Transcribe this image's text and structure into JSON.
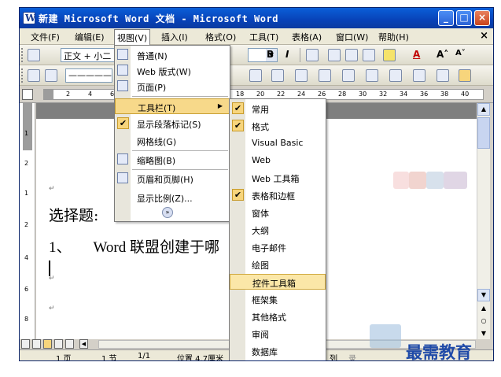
{
  "window": {
    "title": "新建 Microsoft Word 文档 - Microsoft Word",
    "controls": {
      "minimize": "_",
      "maximize": "□",
      "close": "×"
    }
  },
  "menubar": {
    "items": [
      "文件(F)",
      "编辑(E)",
      "视图(V)",
      "插入(I)",
      "格式(O)",
      "工具(T)",
      "表格(A)",
      "窗口(W)",
      "帮助(H)"
    ],
    "close_glyph": "×"
  },
  "toolbar": {
    "style_combo": "正文 + 小二",
    "font_combo": "—————",
    "bold": "B",
    "italic": "I",
    "font_size_big": "A˄",
    "font_size_small": "A˅",
    "font_color": "A"
  },
  "ruler": {
    "numbers": [
      "2",
      "4",
      "6",
      "18",
      "20",
      "22",
      "24",
      "26",
      "28",
      "30",
      "32",
      "34",
      "36",
      "38",
      "40"
    ]
  },
  "vertical_ruler": {
    "numbers": [
      "1",
      "2",
      "1",
      "2",
      "4",
      "6",
      "8"
    ]
  },
  "document": {
    "line1": "选择题:",
    "line2_num": "1、",
    "line2_text": "Word 联盟创建于哪",
    "para_mark": "↵"
  },
  "view_menu": {
    "items": [
      {
        "label": "普通(N)",
        "icon": "normal-view-icon"
      },
      {
        "label": "Web 版式(W)",
        "icon": "web-layout-icon"
      },
      {
        "label": "页面(P)",
        "icon": "page-view-icon"
      },
      {
        "label": "工具栏(T)",
        "submenu": true,
        "highlighted": true
      },
      {
        "label": "显示段落标记(S)",
        "checked": true
      },
      {
        "label": "网格线(G)"
      },
      {
        "label": "缩略图(B)",
        "icon": "thumbnail-icon"
      },
      {
        "label": "页眉和页脚(H)",
        "icon": "header-footer-icon"
      },
      {
        "label": "显示比例(Z)..."
      }
    ],
    "more_glyph": "»"
  },
  "toolbars_submenu": {
    "items": [
      {
        "label": "常用",
        "checked": true
      },
      {
        "label": "格式",
        "checked": true
      },
      {
        "label": "Visual Basic"
      },
      {
        "label": "Web"
      },
      {
        "label": "Web 工具箱"
      },
      {
        "label": "表格和边框",
        "checked": true
      },
      {
        "label": "窗体"
      },
      {
        "label": "大纲"
      },
      {
        "label": "电子邮件"
      },
      {
        "label": "绘图"
      },
      {
        "label": "控件工具箱",
        "highlighted": true
      },
      {
        "label": "框架集"
      },
      {
        "label": "其他格式"
      },
      {
        "label": "审阅"
      },
      {
        "label": "数据库"
      }
    ]
  },
  "statusbar": {
    "page": "1 页",
    "section": "1 节",
    "pages": "1/1",
    "position": "位置 4.7厘米",
    "col": "列",
    "rec": "录"
  },
  "watermark": "最需教育",
  "colors": {
    "titlebar": "#0842b8",
    "menu_highlight": "#f7d98a",
    "check_bg": "#f7d57c",
    "watermark": "#1f4aa8"
  }
}
